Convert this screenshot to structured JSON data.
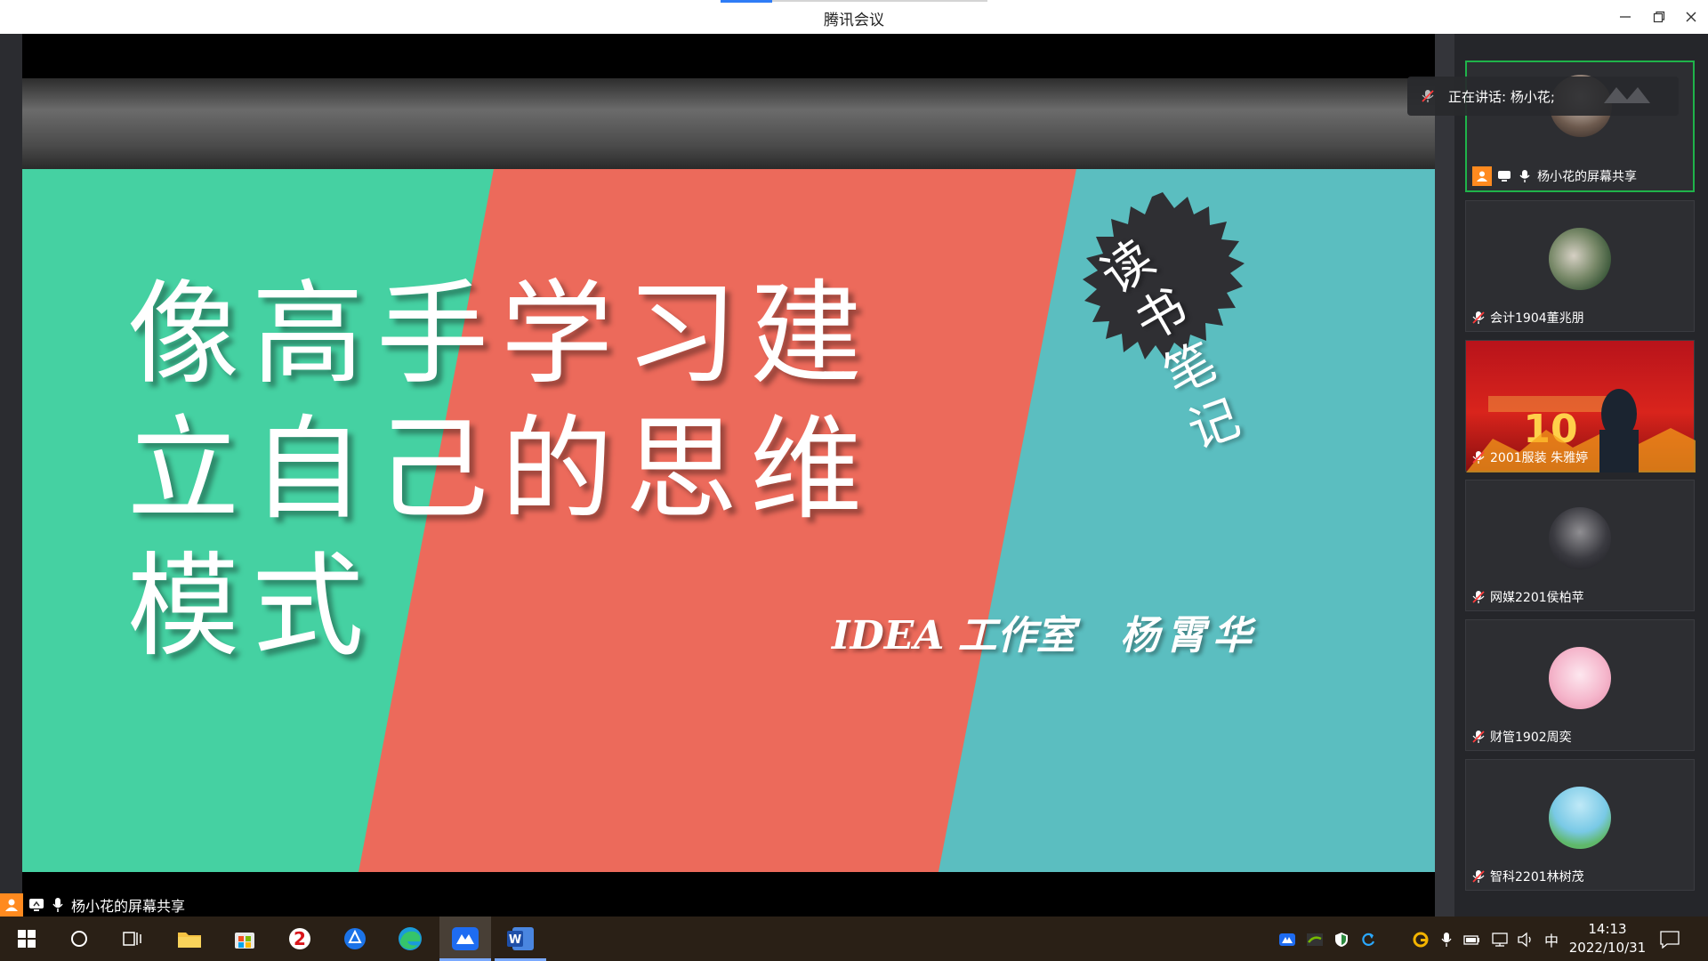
{
  "window": {
    "title": "腾讯会议",
    "minimize_icon": "minimize-icon",
    "restore_icon": "restore-icon",
    "close_icon": "close-icon"
  },
  "slide": {
    "title_line1": "像高手学习建",
    "title_line2": "立自己的思维",
    "title_line3": "模式",
    "badge_char1": "读",
    "badge_char2": "书",
    "badge_char3": "笔",
    "badge_char4": "记",
    "studio": "IDEA 工作室",
    "author": "杨霄华",
    "colors": {
      "green": "#45d1a2",
      "red": "#ec6a5b",
      "teal": "#5bbec0",
      "dark": "#2f2f33"
    }
  },
  "share": {
    "label": "杨小花的屏幕共享"
  },
  "speaking": {
    "label": "正在讲话: 杨小花;"
  },
  "participants": [
    {
      "name": "杨小花的屏幕共享",
      "active": true
    },
    {
      "name": "会计1904董兆朋",
      "active": false
    },
    {
      "name": "2001服装 朱雅婷",
      "active": false
    },
    {
      "name": "网媒2201侯柏苹",
      "active": false
    },
    {
      "name": "财管1902周奕",
      "active": false
    },
    {
      "name": "智科2201林树茂",
      "active": false
    }
  ],
  "taskbar": {
    "ime": "中",
    "time": "14:13",
    "date": "2022/10/31"
  }
}
